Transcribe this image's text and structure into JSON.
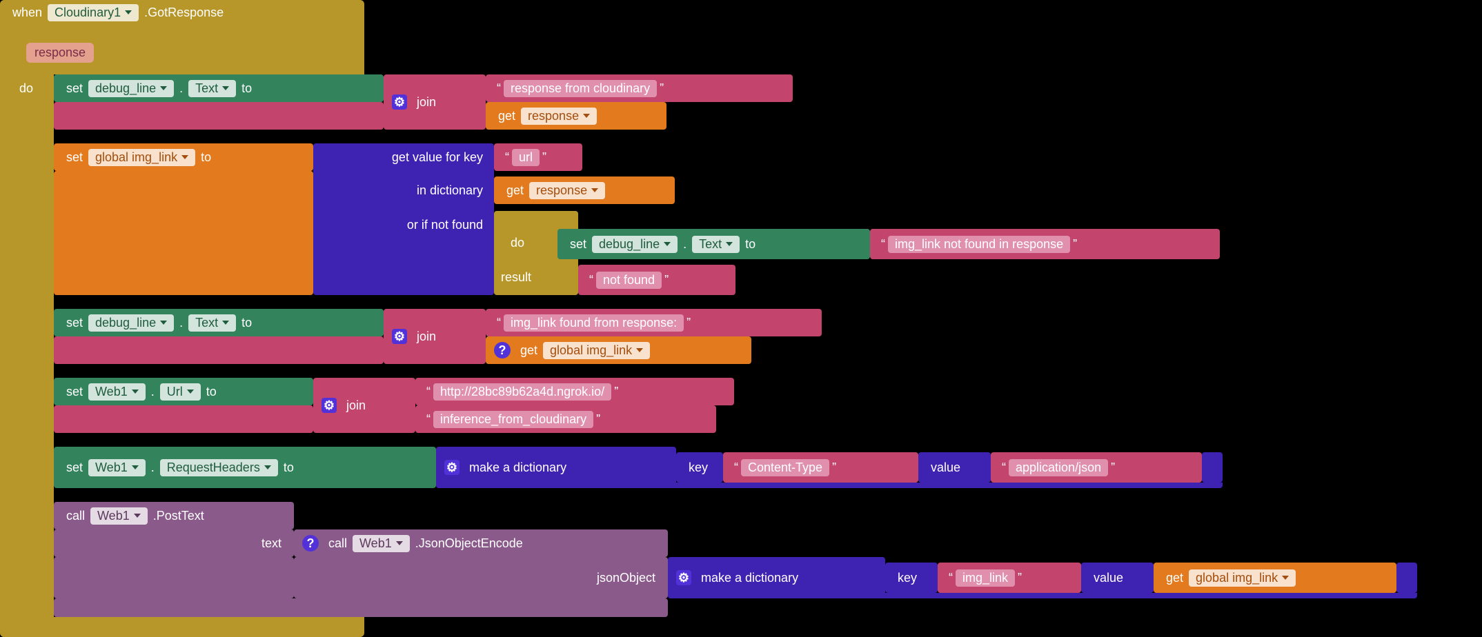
{
  "event": {
    "when": "when",
    "component": "Cloudinary1",
    "suffix": ".GotResponse",
    "param_name": "response",
    "do": "do",
    "result_label": "result"
  },
  "kw": {
    "set": "set",
    "to": "to",
    "get": "get",
    "call": "call",
    "join": "join",
    "key": "key",
    "value": "value",
    "dot": "."
  },
  "dict": {
    "get_value_for_key": "get value for key",
    "in_dictionary": "in dictionary",
    "or_if_not_found": "or if not found",
    "make_a_dictionary": "make a dictionary"
  },
  "set1": {
    "comp": "debug_line",
    "prop": "Text"
  },
  "join1": {
    "s1": "response from cloudinary"
  },
  "get_resp": "response",
  "set2": {
    "var": "global img_link"
  },
  "url_key": "url",
  "inner_set": {
    "comp": "debug_line",
    "prop": "Text",
    "msg": "img_link not found in response"
  },
  "not_found": "not found",
  "set3": {
    "comp": "debug_line",
    "prop": "Text"
  },
  "join3": {
    "s1": "img_link found from response:"
  },
  "get_gil": "global img_link",
  "set4": {
    "comp": "Web1",
    "prop": "Url"
  },
  "join4": {
    "s1": "http://28bc89b62a4d.ngrok.io/",
    "s2": "inference_from_cloudinary"
  },
  "set5": {
    "comp": "Web1",
    "prop": "RequestHeaders"
  },
  "hdr": {
    "k": "Content-Type",
    "v": "application/json"
  },
  "call1": {
    "comp": "Web1",
    "method": ".PostText",
    "arg_label": "text"
  },
  "call2": {
    "comp": "Web1",
    "method": ".JsonObjectEncode",
    "arg_label": "jsonObject"
  },
  "body": {
    "k": "img_link"
  }
}
